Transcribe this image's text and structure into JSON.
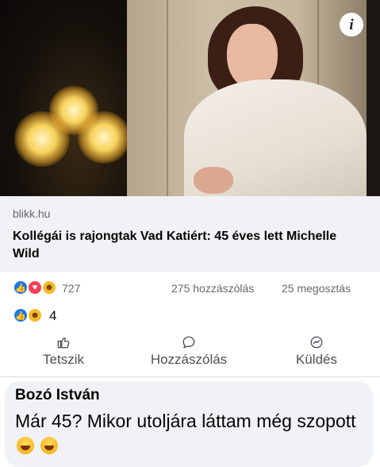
{
  "post": {
    "image_alt": "article preview photo",
    "link": {
      "domain": "blikk.hu",
      "title": "Kollégái is rajongtak Vad Katiért: 45 éves lett Michelle Wild"
    },
    "reactions": {
      "total": "727",
      "comments": "275 hozzászólás",
      "shares": "25 megosztás"
    },
    "actions": {
      "like": "Tetszik",
      "comment": "Hozzászólás",
      "send": "Küldés"
    }
  },
  "comment": {
    "reactions_count": "4",
    "author": "Bozó István",
    "text": "Már 45? Mikor utoljára láttam még szopott"
  },
  "icons": {
    "info": "info-icon",
    "like": "thumbs-up-icon",
    "comment": "speech-bubble-icon",
    "send": "messenger-icon"
  },
  "colors": {
    "like_blue": "#1877f2",
    "love_red": "#f33e58",
    "haha_yellow": "#f7b928",
    "secondary_text": "#65676b",
    "bubble_bg": "#f0f2f5"
  }
}
